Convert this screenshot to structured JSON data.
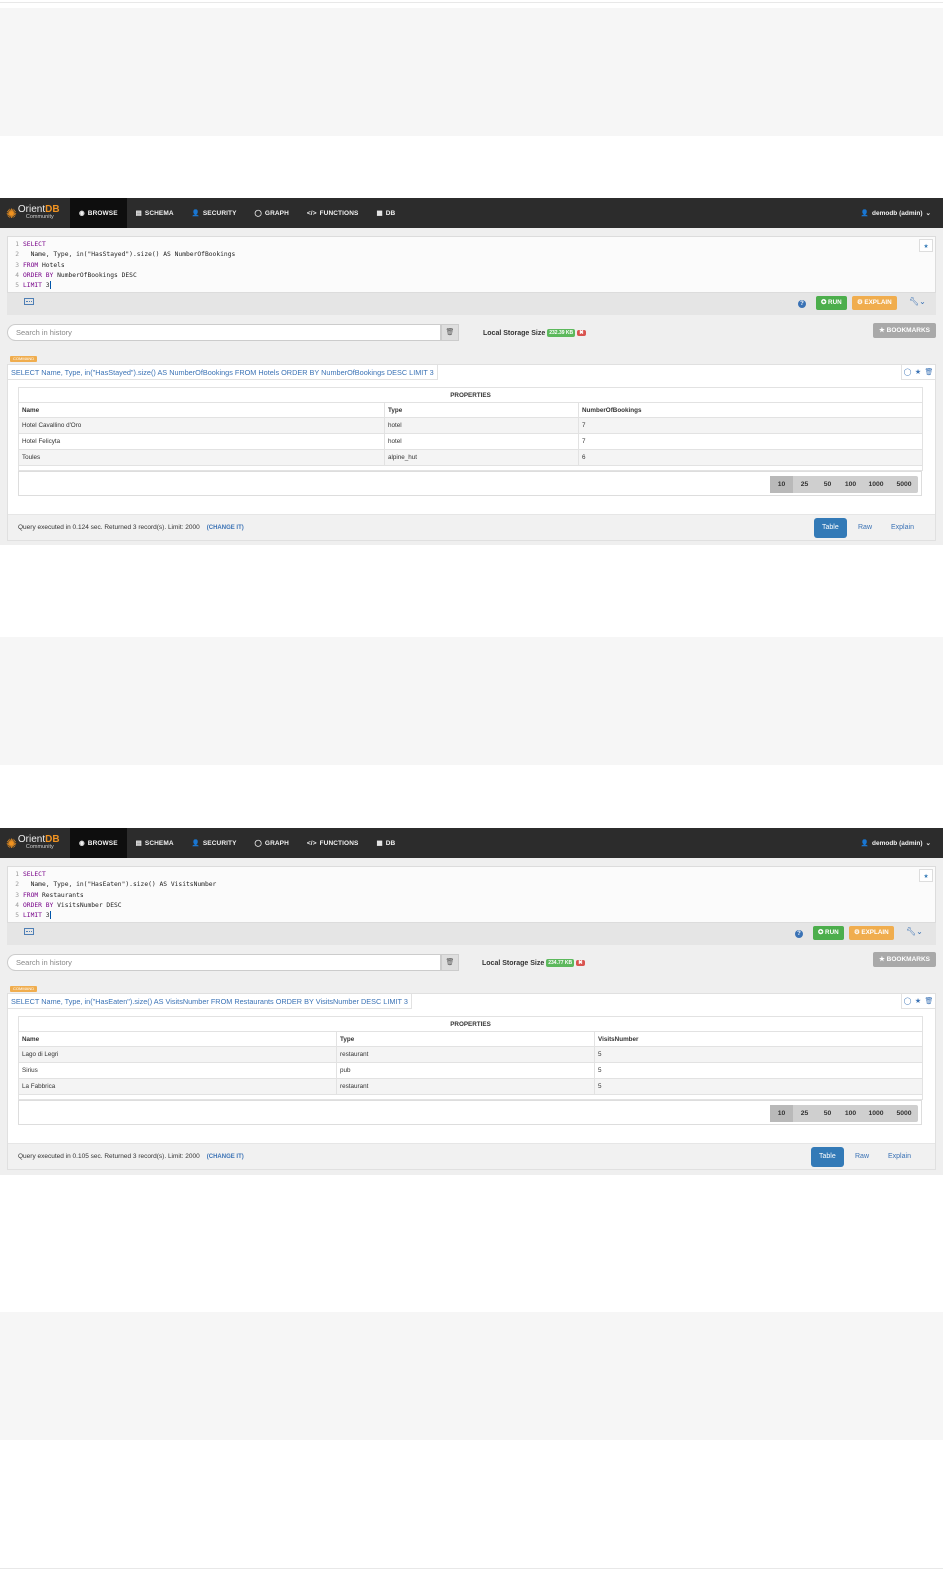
{
  "panels": [
    {
      "nav": {
        "logo_main_a": "Orient",
        "logo_main_b": "DB",
        "logo_sub": "Community",
        "items": [
          {
            "icon": "eye-icon",
            "glyph": "◉",
            "label": "BROWSE"
          },
          {
            "icon": "schema-icon",
            "glyph": "▤",
            "label": "SCHEMA"
          },
          {
            "icon": "user-icon",
            "glyph": "👤",
            "label": "SECURITY"
          },
          {
            "icon": "graph-icon",
            "glyph": "◯",
            "label": "GRAPH"
          },
          {
            "icon": "code-icon",
            "glyph": "</>",
            "label": "FUNCTIONS"
          },
          {
            "icon": "database-icon",
            "glyph": "▦",
            "label": "DB"
          }
        ],
        "user": "demodb (admin)"
      },
      "editor": {
        "lines": [
          {
            "n": "1",
            "kw": "SELECT",
            "rest": ""
          },
          {
            "n": "2",
            "kw": "",
            "rest": "  Name, Type, in(\"HasStayed\").size() AS NumberOfBookings"
          },
          {
            "n": "3",
            "kw": "FROM",
            "rest": " Hotels"
          },
          {
            "n": "4",
            "kw": "ORDER BY",
            "rest": " NumberOfBookings DESC"
          },
          {
            "n": "5",
            "kw": "LIMIT",
            "rest": " 3"
          }
        ]
      },
      "toolbar": {
        "run": "RUN",
        "explain": "EXPLAIN"
      },
      "history_placeholder": "Search in history",
      "local_storage": {
        "label": "Local Storage Size",
        "value": "232.39 KB"
      },
      "bookmarks": "BOOKMARKS",
      "command_badge": "COMMAND",
      "query": "SELECT Name, Type, in(\"HasStayed\").size() AS NumberOfBookings FROM Hotels ORDER BY NumberOfBookings DESC LIMIT 3",
      "table": {
        "caption": "PROPERTIES",
        "headers": [
          "Name",
          "Type",
          "NumberOfBookings"
        ],
        "rows": [
          [
            "Hotel Cavallino d'Oro",
            "hotel",
            "7"
          ],
          [
            "Hotel Felicyta",
            "hotel",
            "7"
          ],
          [
            "Toules",
            "alpine_hut",
            "6"
          ]
        ]
      },
      "page_sizes": [
        "10",
        "25",
        "50",
        "100",
        "1000",
        "5000"
      ],
      "exec_text": "Query executed in 0.124 sec. Returned 3 record(s). Limit: 2000",
      "change_it": "(CHANGE IT)",
      "tabs": [
        "Table",
        "Raw",
        "Explain"
      ]
    },
    {
      "nav": {
        "logo_main_a": "Orient",
        "logo_main_b": "DB",
        "logo_sub": "Community",
        "items": [
          {
            "icon": "eye-icon",
            "glyph": "◉",
            "label": "BROWSE"
          },
          {
            "icon": "schema-icon",
            "glyph": "▤",
            "label": "SCHEMA"
          },
          {
            "icon": "user-icon",
            "glyph": "👤",
            "label": "SECURITY"
          },
          {
            "icon": "graph-icon",
            "glyph": "◯",
            "label": "GRAPH"
          },
          {
            "icon": "code-icon",
            "glyph": "</>",
            "label": "FUNCTIONS"
          },
          {
            "icon": "database-icon",
            "glyph": "▦",
            "label": "DB"
          }
        ],
        "user": "demodb (admin)"
      },
      "editor": {
        "lines": [
          {
            "n": "1",
            "kw": "SELECT",
            "rest": ""
          },
          {
            "n": "2",
            "kw": "",
            "rest": "  Name, Type, in(\"HasEaten\").size() AS VisitsNumber"
          },
          {
            "n": "3",
            "kw": "FROM",
            "rest": " Restaurants"
          },
          {
            "n": "4",
            "kw": "ORDER BY",
            "rest": " VisitsNumber DESC"
          },
          {
            "n": "5",
            "kw": "LIMIT",
            "rest": " 3"
          }
        ]
      },
      "toolbar": {
        "run": "RUN",
        "explain": "EXPLAIN"
      },
      "history_placeholder": "Search in history",
      "local_storage": {
        "label": "Local Storage Size",
        "value": "234.77 KB"
      },
      "bookmarks": "BOOKMARKS",
      "command_badge": "COMMAND",
      "query": "SELECT Name, Type, in(\"HasEaten\").size() AS VisitsNumber FROM Restaurants ORDER BY VisitsNumber DESC LIMIT 3",
      "table": {
        "caption": "PROPERTIES",
        "headers": [
          "Name",
          "Type",
          "VisitsNumber"
        ],
        "rows": [
          [
            "Lago di Legri",
            "restaurant",
            "5"
          ],
          [
            "Sirius",
            "pub",
            "5"
          ],
          [
            "La Fabbrica",
            "restaurant",
            "5"
          ]
        ]
      },
      "page_sizes": [
        "10",
        "25",
        "50",
        "100",
        "1000",
        "5000"
      ],
      "exec_text": "Query executed in 0.105 sec. Returned 3 record(s). Limit: 2000",
      "change_it": "(CHANGE IT)",
      "tabs": [
        "Table",
        "Raw",
        "Explain"
      ]
    }
  ]
}
